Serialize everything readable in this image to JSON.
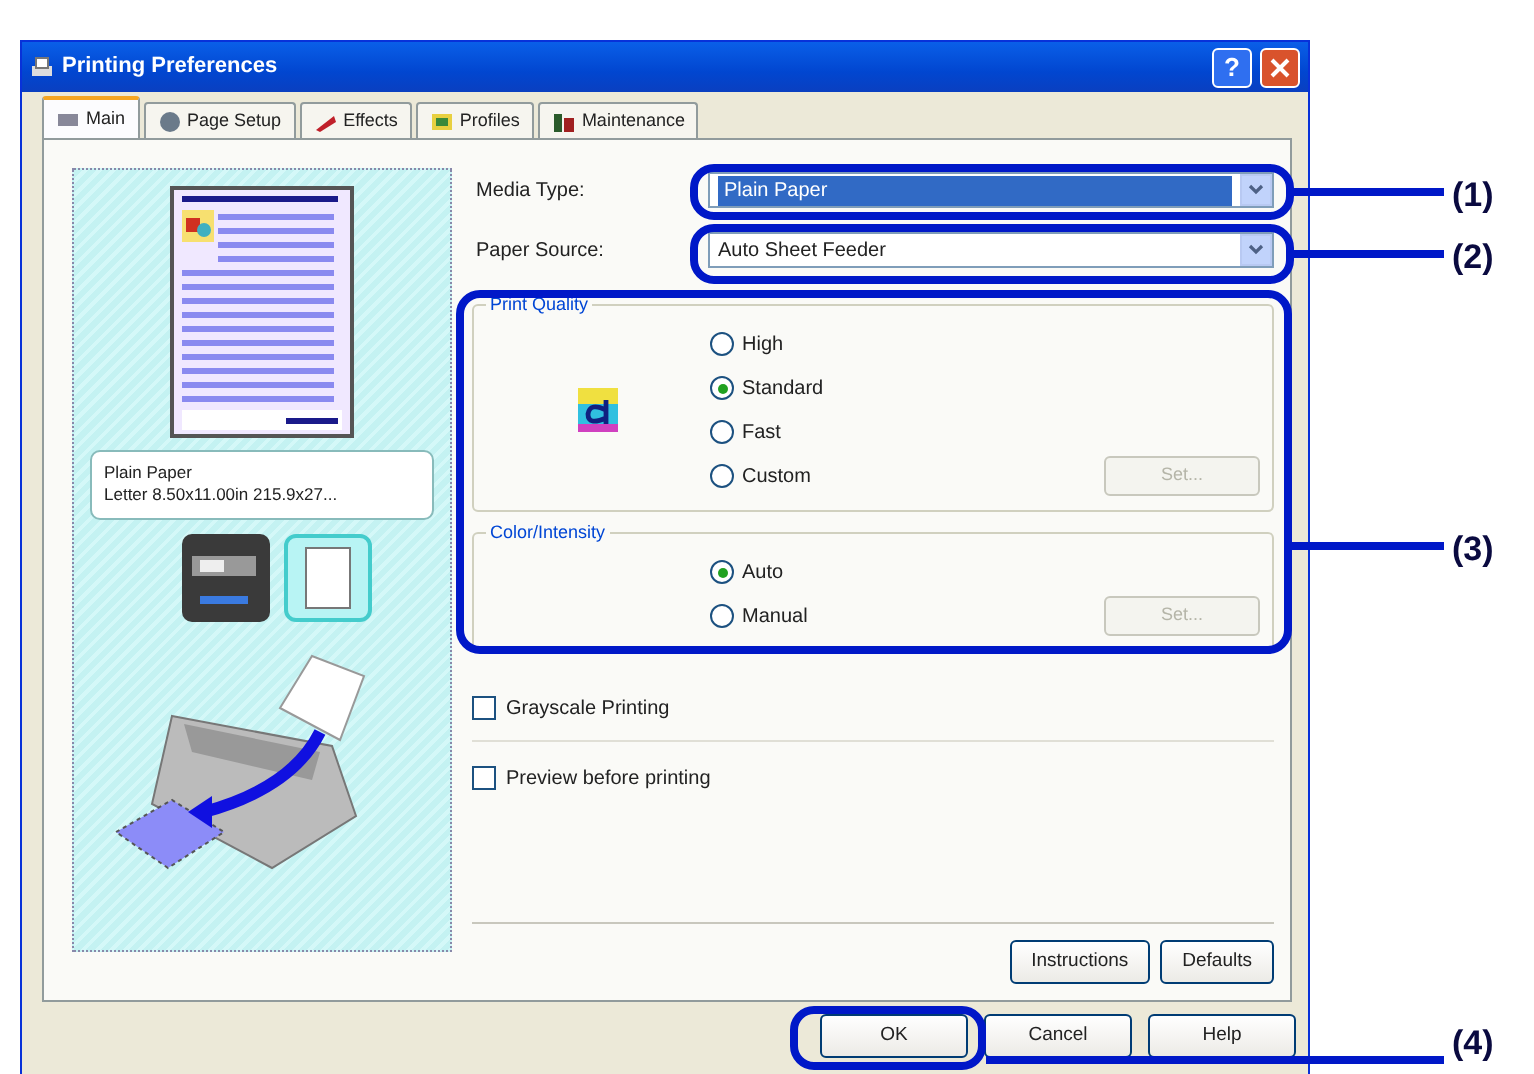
{
  "window": {
    "title": "Printing Preferences",
    "help_glyph": "?"
  },
  "tabs": [
    {
      "label": "Main",
      "selected": true
    },
    {
      "label": "Page Setup",
      "selected": false
    },
    {
      "label": "Effects",
      "selected": false
    },
    {
      "label": "Profiles",
      "selected": false
    },
    {
      "label": "Maintenance",
      "selected": false
    }
  ],
  "preview": {
    "media": "Plain Paper",
    "size": "Letter 8.50x11.00in 215.9x27..."
  },
  "media_type": {
    "label": "Media Type:",
    "value": "Plain Paper"
  },
  "paper_source": {
    "label": "Paper Source:",
    "value": "Auto Sheet Feeder"
  },
  "print_quality": {
    "title": "Print Quality",
    "options": [
      {
        "label": "High",
        "selected": false
      },
      {
        "label": "Standard",
        "selected": true
      },
      {
        "label": "Fast",
        "selected": false
      },
      {
        "label": "Custom",
        "selected": false
      }
    ],
    "set_button": {
      "label": "Set...",
      "disabled": true
    }
  },
  "color_intensity": {
    "title": "Color/Intensity",
    "options": [
      {
        "label": "Auto",
        "selected": true
      },
      {
        "label": "Manual",
        "selected": false
      }
    ],
    "set_button": {
      "label": "Set...",
      "disabled": true
    }
  },
  "checkboxes": [
    {
      "label": "Grayscale Printing",
      "checked": false
    },
    {
      "label": "Preview before printing",
      "checked": false
    }
  ],
  "panel_buttons": [
    "Instructions",
    "Defaults"
  ],
  "dialog_buttons": [
    "OK",
    "Cancel",
    "Help"
  ],
  "callouts": [
    "(1)",
    "(2)",
    "(3)",
    "(4)"
  ]
}
